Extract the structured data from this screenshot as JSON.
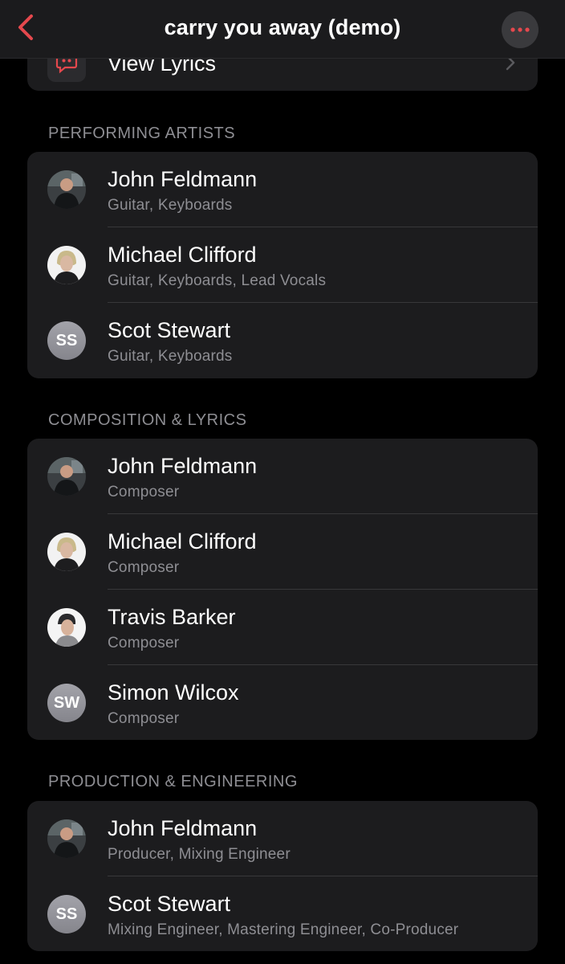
{
  "nav": {
    "title": "carry you away (demo)",
    "back_icon": "chevron-left-icon",
    "more_icon": "ellipsis-icon",
    "accent_color": "#e5484d"
  },
  "lyrics": {
    "label": "View Lyrics",
    "icon": "quote-bubble-icon"
  },
  "sections": [
    {
      "header": "PERFORMING ARTISTS",
      "rows": [
        {
          "name": "John Feldmann",
          "role": "Guitar, Keyboards",
          "avatar": "photo"
        },
        {
          "name": "Michael Clifford",
          "role": "Guitar, Keyboards, Lead Vocals",
          "avatar": "photo"
        },
        {
          "name": "Scot Stewart",
          "role": "Guitar, Keyboards",
          "avatar": "SS"
        }
      ]
    },
    {
      "header": "COMPOSITION & LYRICS",
      "rows": [
        {
          "name": "John Feldmann",
          "role": "Composer",
          "avatar": "photo"
        },
        {
          "name": "Michael Clifford",
          "role": "Composer",
          "avatar": "photo"
        },
        {
          "name": "Travis Barker",
          "role": "Composer",
          "avatar": "photo"
        },
        {
          "name": "Simon Wilcox",
          "role": "Composer",
          "avatar": "SW"
        }
      ]
    },
    {
      "header": "PRODUCTION & ENGINEERING",
      "rows": [
        {
          "name": "John Feldmann",
          "role": "Producer, Mixing Engineer",
          "avatar": "photo"
        },
        {
          "name": "Scot Stewart",
          "role": "Mixing Engineer, Mastering Engineer, Co-Producer",
          "avatar": "SS"
        }
      ]
    }
  ]
}
